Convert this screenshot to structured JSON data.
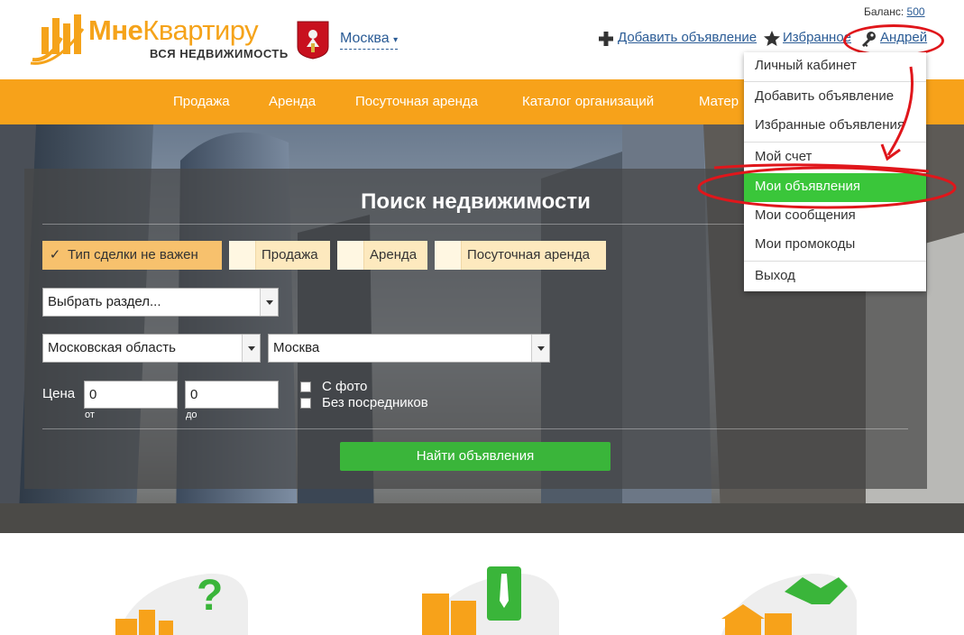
{
  "brand": {
    "name_bold": "Мне",
    "name_rest": "Квартиру",
    "tagline": "ВСЯ НЕДВИЖИМОСТЬ",
    "accent": "#f7a21a"
  },
  "city": {
    "name": "Москва",
    "arrow": "▾"
  },
  "balance": {
    "label": "Баланс:",
    "value": "500"
  },
  "top_links": {
    "add": "Добавить объявление",
    "favorites": "Избранное",
    "user": "Андрей"
  },
  "nav": [
    "Продажа",
    "Аренда",
    "Посуточная аренда",
    "Каталог организаций",
    "Матер"
  ],
  "search": {
    "title": "Поиск недвижимости",
    "deal_types": [
      {
        "label": "Тип сделки не важен",
        "checked": true
      },
      {
        "label": "Продажа",
        "checked": false
      },
      {
        "label": "Аренда",
        "checked": false
      },
      {
        "label": "Посуточная аренда",
        "checked": false
      }
    ],
    "section_select": "Выбрать раздел...",
    "region_select": "Московская область",
    "city_select": "Москва",
    "price_label": "Цена",
    "price_from": "0",
    "price_to": "0",
    "from_label": "от",
    "to_label": "до",
    "with_photo": "С фото",
    "no_agents": "Без посредников",
    "submit": "Найти объявления",
    "button_color": "#3ab53a"
  },
  "user_menu": {
    "items": [
      "Личный кабинет",
      "Добавить объявление",
      "Избранные объявления",
      "Мой счет",
      "Мои объявления",
      "Мои сообщения",
      "Мои промокоды",
      "Выход"
    ],
    "active_item": "Мои объявления",
    "highlight_color": "#3ac63a",
    "annotation_color": "#e0161b"
  }
}
